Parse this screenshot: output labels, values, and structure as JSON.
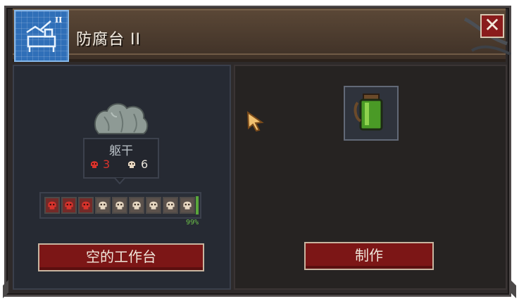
{
  "window": {
    "title": "防腐台 II",
    "close_symbol": "✕"
  },
  "title_icon": {
    "icon": "blueprint-workbench-icon",
    "badge": "II"
  },
  "ingredient": {
    "name": "躯干",
    "icon": "torso-bodies-icon",
    "red_skull_count": "3",
    "bone_skull_count": "6",
    "colors": {
      "red": "#d8332c",
      "bone": "#e6d7c2"
    }
  },
  "quality_bar": {
    "red_skulls": 3,
    "bone_skulls": 6,
    "percent_label": "99%"
  },
  "buttons": {
    "workbench_label": "空的工作台",
    "craft_label": "制作"
  },
  "product": {
    "icon": "green-potion-jar-icon"
  },
  "colors": {
    "accent_red": "#7c1616",
    "title_bar": "#4c3c2e",
    "panel_left": "#262a33",
    "panel_right": "#262322",
    "progress_green": "#5aa63b"
  }
}
